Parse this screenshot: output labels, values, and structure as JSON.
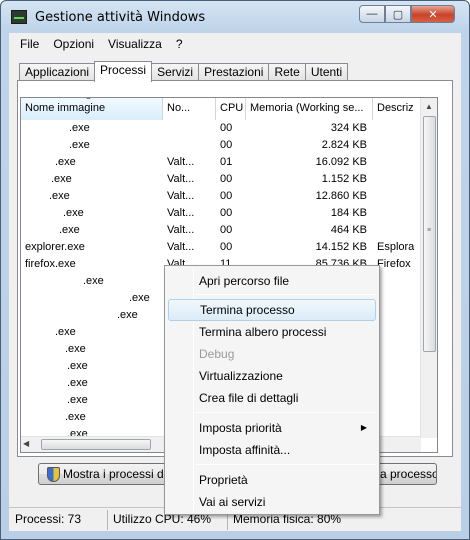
{
  "window": {
    "title": "Gestione attività Windows"
  },
  "menu": [
    "File",
    "Opzioni",
    "Visualizza",
    "?"
  ],
  "tabs": [
    "Applicazioni",
    "Processi",
    "Servizi",
    "Prestazioni",
    "Rete",
    "Utenti"
  ],
  "active_tab": "Processi",
  "columns": [
    "Nome immagine",
    "No...",
    "CPU",
    "Memoria (Working se...",
    "Descriz"
  ],
  "processes": [
    {
      "name": ".exe",
      "user": "",
      "cpu": "00",
      "mem": "324 KB",
      "desc": ""
    },
    {
      "name": ".exe",
      "user": "",
      "cpu": "00",
      "mem": "2.824 KB",
      "desc": ""
    },
    {
      "name": ".exe",
      "user": "Valt...",
      "cpu": "01",
      "mem": "16.092 KB",
      "desc": ""
    },
    {
      "name": ".exe",
      "user": "Valt...",
      "cpu": "00",
      "mem": "1.152 KB",
      "desc": ""
    },
    {
      "name": ".exe",
      "user": "Valt...",
      "cpu": "00",
      "mem": "12.860 KB",
      "desc": ""
    },
    {
      "name": ".exe",
      "user": "Valt...",
      "cpu": "00",
      "mem": "184 KB",
      "desc": ""
    },
    {
      "name": ".exe",
      "user": "Valt...",
      "cpu": "00",
      "mem": "464 KB",
      "desc": ""
    },
    {
      "name": "explorer.exe",
      "user": "Valt...",
      "cpu": "00",
      "mem": "14.152 KB",
      "desc": "Esplora"
    },
    {
      "name": "firefox.exe",
      "user": "Valt...",
      "cpu": "11",
      "mem": "85.736 KB",
      "desc": "Firefox"
    },
    {
      "name": ".exe",
      "user": "",
      "cpu": "",
      "mem": "",
      "desc": ""
    },
    {
      "name": ".exe",
      "user": "",
      "cpu": "",
      "mem": "",
      "desc": ""
    },
    {
      "name": ".exe",
      "user": "",
      "cpu": "",
      "mem": "",
      "desc": ""
    },
    {
      "name": ".exe",
      "user": "",
      "cpu": "",
      "mem": "",
      "desc": ""
    },
    {
      "name": ".exe",
      "user": "",
      "cpu": "",
      "mem": "",
      "desc": ""
    },
    {
      "name": ".exe",
      "user": "",
      "cpu": "",
      "mem": "",
      "desc": ""
    },
    {
      "name": ".exe",
      "user": "",
      "cpu": "",
      "mem": "",
      "desc": ""
    },
    {
      "name": ".exe",
      "user": "",
      "cpu": "",
      "mem": "",
      "desc": ""
    },
    {
      "name": ".exe",
      "user": "",
      "cpu": "",
      "mem": "",
      "desc": ""
    },
    {
      "name": ".exe",
      "user": "",
      "cpu": "",
      "mem": "",
      "desc": ""
    }
  ],
  "buttons": {
    "show_all": "Mostra i processi di tu",
    "end_process": "a processo"
  },
  "status": {
    "processes": "Processi: 73",
    "cpu": "Utilizzo CPU: 46%",
    "memory": "Memoria fisica: 80%"
  },
  "context_menu": {
    "open_location": "Apri percorso file",
    "end_process": "Termina processo",
    "end_tree": "Termina albero processi",
    "debug": "Debug",
    "virtualization": "Virtualizzazione",
    "create_dump": "Crea file di dettagli",
    "set_priority": "Imposta priorità",
    "set_affinity": "Imposta affinità...",
    "properties": "Proprietà",
    "go_to_services": "Vai ai servizi"
  }
}
